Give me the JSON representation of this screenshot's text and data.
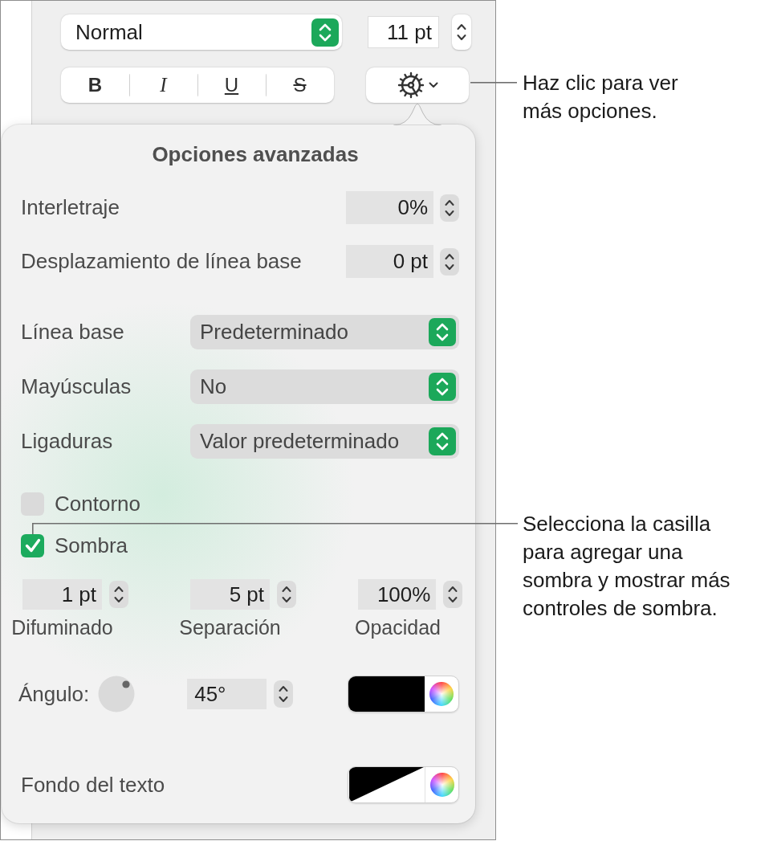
{
  "toolbar": {
    "paragraph_style": {
      "value": "Normal"
    },
    "font_size": {
      "value": "11 pt"
    },
    "text_styles": [
      {
        "label": "B",
        "kind": "bold",
        "selected": false
      },
      {
        "label": "I",
        "kind": "italic",
        "selected": false
      },
      {
        "label": "U",
        "kind": "underline",
        "selected": false
      },
      {
        "label": "S",
        "kind": "strikethrough",
        "selected": false
      }
    ]
  },
  "popover": {
    "title": "Opciones avanzadas",
    "steppers": [
      {
        "label": "Interletraje",
        "value": "0%"
      },
      {
        "label": "Desplazamiento de línea base",
        "value": "0 pt"
      }
    ],
    "popups": [
      {
        "label": "Línea base",
        "value": "Predeterminado"
      },
      {
        "label": "Mayúsculas",
        "value": "No"
      },
      {
        "label": "Ligaduras",
        "value": "Valor predeterminado"
      }
    ],
    "checkboxes": [
      {
        "label": "Contorno",
        "checked": false
      },
      {
        "label": "Sombra",
        "checked": true
      }
    ],
    "shadow_fields": [
      {
        "value": "1 pt",
        "label": "Difuminado"
      },
      {
        "value": "5 pt",
        "label": "Separación"
      },
      {
        "value": "100%",
        "label": "Opacidad"
      }
    ],
    "angle": {
      "label": "Ángulo:",
      "value": "45°",
      "color": "#000000"
    },
    "text_background": {
      "label": "Fondo del texto",
      "color": "#000000"
    }
  },
  "callouts": [
    {
      "text": "Haz clic para ver\nmás opciones."
    },
    {
      "text": "Selecciona la casilla\npara agregar una\nsombra y mostrar más\ncontroles de sombra."
    }
  ]
}
